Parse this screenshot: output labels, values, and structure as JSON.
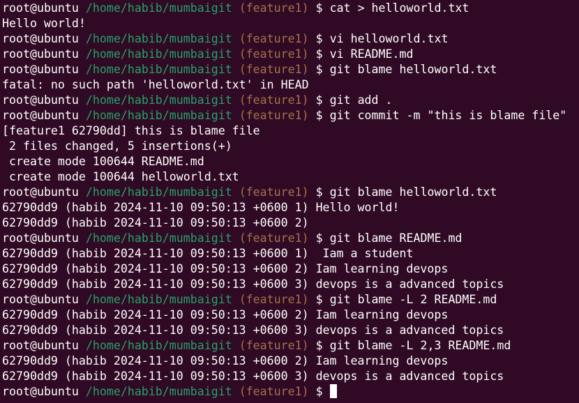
{
  "prompt": {
    "user_host": "root@ubuntu",
    "path": "/home/habib/mumbaigit",
    "branch": "(feature1)",
    "symbol": "$"
  },
  "lines": [
    {
      "type": "prompt",
      "text": "cat > helloworld.txt"
    },
    {
      "type": "output",
      "text": "Hello world!"
    },
    {
      "type": "prompt",
      "text": "vi helloworld.txt"
    },
    {
      "type": "prompt",
      "text": "vi README.md"
    },
    {
      "type": "prompt",
      "text": "git blame helloworld.txt"
    },
    {
      "type": "output",
      "text": "fatal: no such path 'helloworld.txt' in HEAD"
    },
    {
      "type": "prompt",
      "text": "git add ."
    },
    {
      "type": "prompt",
      "text": "git commit -m \"this is blame file\""
    },
    {
      "type": "output",
      "text": "[feature1 62790dd] this is blame file"
    },
    {
      "type": "output",
      "text": " 2 files changed, 5 insertions(+)"
    },
    {
      "type": "output",
      "text": " create mode 100644 README.md"
    },
    {
      "type": "output",
      "text": " create mode 100644 helloworld.txt"
    },
    {
      "type": "prompt",
      "text": "git blame helloworld.txt"
    },
    {
      "type": "output",
      "text": "62790dd9 (habib 2024-11-10 09:50:13 +0600 1) Hello world!"
    },
    {
      "type": "output",
      "text": "62790dd9 (habib 2024-11-10 09:50:13 +0600 2)"
    },
    {
      "type": "prompt",
      "text": "git blame README.md"
    },
    {
      "type": "output",
      "text": "62790dd9 (habib 2024-11-10 09:50:13 +0600 1)  Iam a student"
    },
    {
      "type": "output",
      "text": "62790dd9 (habib 2024-11-10 09:50:13 +0600 2) Iam learning devops"
    },
    {
      "type": "output",
      "text": "62790dd9 (habib 2024-11-10 09:50:13 +0600 3) devops is a advanced topics"
    },
    {
      "type": "prompt",
      "text": "git blame -L 2 README.md"
    },
    {
      "type": "output",
      "text": "62790dd9 (habib 2024-11-10 09:50:13 +0600 2) Iam learning devops"
    },
    {
      "type": "output",
      "text": "62790dd9 (habib 2024-11-10 09:50:13 +0600 3) devops is a advanced topics"
    },
    {
      "type": "prompt",
      "text": "git blame -L 2,3 README.md"
    },
    {
      "type": "output",
      "text": "62790dd9 (habib 2024-11-10 09:50:13 +0600 2) Iam learning devops"
    },
    {
      "type": "output",
      "text": "62790dd9 (habib 2024-11-10 09:50:13 +0600 3) devops is a advanced topics"
    },
    {
      "type": "prompt",
      "text": ""
    }
  ],
  "colors": {
    "background": "#300a24",
    "path": "#26a269",
    "branch": "#a2734c",
    "text": "#ffffff"
  }
}
